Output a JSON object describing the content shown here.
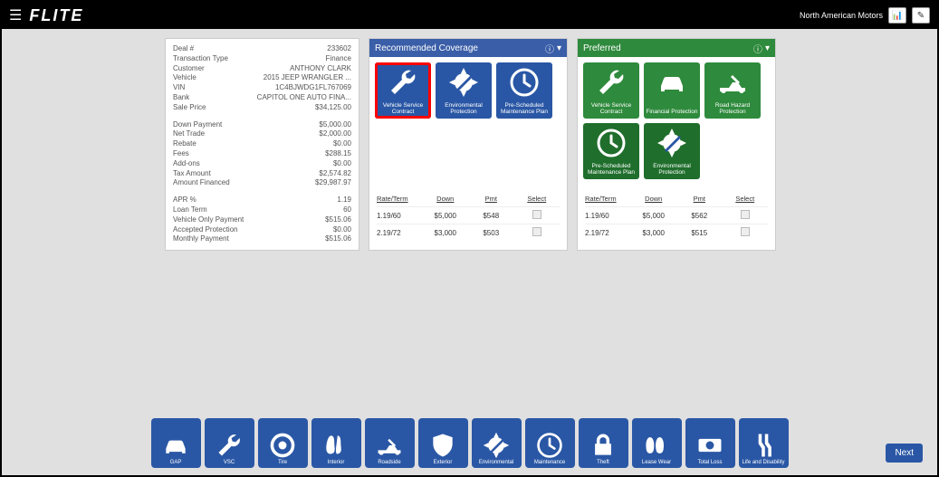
{
  "header": {
    "logo": "FLITE",
    "dealer": "North American Motors"
  },
  "deal": {
    "rows1": [
      {
        "label": "Deal #",
        "value": "233602"
      },
      {
        "label": "Transaction Type",
        "value": "Finance"
      },
      {
        "label": "Customer",
        "value": "ANTHONY CLARK"
      },
      {
        "label": "Vehicle",
        "value": "2015 JEEP WRANGLER ..."
      },
      {
        "label": "VIN",
        "value": "1C4BJWDG1FL767069"
      },
      {
        "label": "Bank",
        "value": "CAPITOL ONE AUTO FINA..."
      },
      {
        "label": "Sale Price",
        "value": "$34,125.00"
      }
    ],
    "rows2": [
      {
        "label": "Down Payment",
        "value": "$5,000.00"
      },
      {
        "label": "Net Trade",
        "value": "$2,000.00"
      },
      {
        "label": "Rebate",
        "value": "$0.00"
      },
      {
        "label": "Fees",
        "value": "$288.15"
      },
      {
        "label": "Add-ons",
        "value": "$0.00"
      },
      {
        "label": "Tax Amount",
        "value": "$2,574.82"
      },
      {
        "label": "Amount Financed",
        "value": "$29,987.97"
      }
    ],
    "rows3": [
      {
        "label": "APR %",
        "value": "1.19"
      },
      {
        "label": "Loan Term",
        "value": "60"
      },
      {
        "label": "Vehicle Only Payment",
        "value": "$515.06"
      },
      {
        "label": "Accepted Protection",
        "value": "$0.00"
      },
      {
        "label": "Monthly Payment",
        "value": "$515.06"
      }
    ]
  },
  "recommended": {
    "title": "Recommended Coverage",
    "tiles": [
      {
        "label": "Vehicle Service Contract",
        "icon": "wrench",
        "hl": true
      },
      {
        "label": "Environmental Protection",
        "icon": "env"
      },
      {
        "label": "Pre-Scheduled Maintenance Plan",
        "icon": "clock"
      }
    ],
    "rate_head": {
      "a": "Rate/Term",
      "b": "Down",
      "c": "Pmt",
      "d": "Select"
    },
    "rates": [
      {
        "rate": "1.19/60",
        "down": "$5,000",
        "pmt": "$548"
      },
      {
        "rate": "2.19/72",
        "down": "$3,000",
        "pmt": "$503"
      }
    ]
  },
  "preferred": {
    "title": "Preferred",
    "tiles": [
      {
        "label": "Vehicle Service Contract",
        "icon": "wrench",
        "cls": "green"
      },
      {
        "label": "Financial Protection",
        "icon": "car",
        "cls": "green"
      },
      {
        "label": "Road Hazard Protection",
        "icon": "tow",
        "cls": "green"
      },
      {
        "label": "Pre-Scheduled Maintenance Plan",
        "icon": "clock",
        "cls": "dkgreen"
      },
      {
        "label": "Environmental Protection",
        "icon": "env",
        "cls": "dkgreen"
      }
    ],
    "rate_head": {
      "a": "Rate/Term",
      "b": "Down",
      "c": "Pmt",
      "d": "Select"
    },
    "rates": [
      {
        "rate": "1.19/60",
        "down": "$5,000",
        "pmt": "$562"
      },
      {
        "rate": "2.19/72",
        "down": "$3,000",
        "pmt": "$515"
      }
    ]
  },
  "dock": [
    {
      "label": "GAP",
      "icon": "car"
    },
    {
      "label": "VSC",
      "icon": "wrench"
    },
    {
      "label": "Tire",
      "icon": "tire"
    },
    {
      "label": "Interior",
      "icon": "seat"
    },
    {
      "label": "Roadside",
      "icon": "tow"
    },
    {
      "label": "Exterior",
      "icon": "shield"
    },
    {
      "label": "Environmental",
      "icon": "env"
    },
    {
      "label": "Maintenance",
      "icon": "clock"
    },
    {
      "label": "Theft",
      "icon": "lock"
    },
    {
      "label": "Lease Wear",
      "icon": "seat2"
    },
    {
      "label": "Total Loss",
      "icon": "cash"
    },
    {
      "label": "Life and Disability",
      "icon": "crutch"
    }
  ],
  "next": "Next"
}
